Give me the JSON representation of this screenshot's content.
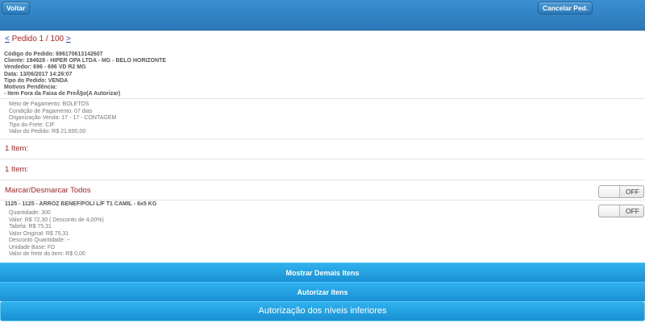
{
  "header": {
    "back_label": "Voltar",
    "cancel_label": "Cancelar Ped."
  },
  "pager": {
    "prev": "<",
    "text": "Pedido 1 / 100",
    "next": ">"
  },
  "order": {
    "code": "Código do Pedido: 696170613142607",
    "client": "Cliente: 194928 - HIPER OPA LTDA - MG - BELO HORIZONTE",
    "seller": "Vendedor: 696 - 696 VD R2 MG",
    "date": "Data: 13/06/2017 14:26:07",
    "type": "Tipo do Pedido: VENDA",
    "reasons_label": "Motivos Pendência:",
    "reason_1": "- Item Fora da Faixa de PreÃ§o(A Autorizar)"
  },
  "details": {
    "payment": "Meio de Pagamento: BOLETOS",
    "condition": "Condição de Pagamento: 07 dias",
    "org": "Organização Venda: 17 - 17 - CONTAGEM",
    "freight_type": "Tipo do Frete: CIF",
    "order_value": "Valor do Pedido: R$ 21.690,00"
  },
  "items_label_1": "1 Item:",
  "items_label_2": "1 Item:",
  "select_all": {
    "label": "Marcar/Desmarcar Todos",
    "toggle": "OFF"
  },
  "item": {
    "title": "1125 - 1125 - ARROZ BENEF/POLI L/F T1 CAMIL - 6x5 KG",
    "toggle": "OFF",
    "quantity": "Quantidade: 300",
    "value": "Valor: R$ 72,30 ( Desconto de 4,00%)",
    "table": "Tabela: R$ 75,31",
    "original_value": "Valor Original: R$ 75,31",
    "qty_discount": "Desconto Quantidade: --",
    "unit": "Unidade Base: FD",
    "freight_value": "Valor de frete do item: R$ 0,00"
  },
  "buttons": {
    "show_more": "Mostrar Demais Itens",
    "authorize": "Autorizar Itens",
    "lower_levels": "Autorização dos níveis inferiores"
  }
}
